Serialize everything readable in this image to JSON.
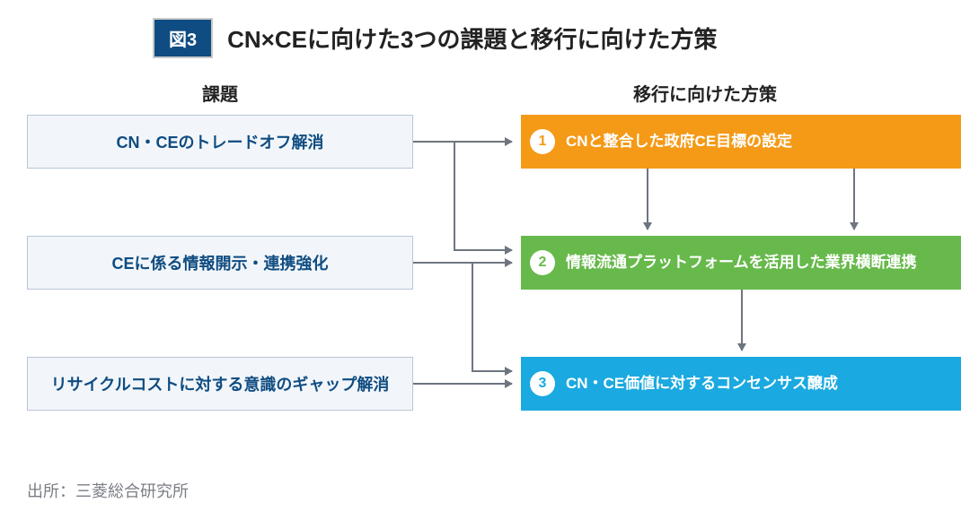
{
  "header": {
    "figure_label": "図3",
    "title": "CN×CEに向けた3つの課題と移行に向けた方策"
  },
  "columns": {
    "left_header": "課題",
    "right_header": "移行に向けた方策"
  },
  "issues": [
    {
      "label": "CN・CEのトレードオフ解消"
    },
    {
      "label": "CEに係る情報開示・連携強化"
    },
    {
      "label": "リサイクルコストに対する意識のギャップ解消"
    }
  ],
  "measures": [
    {
      "num": "1",
      "label": "CNと整合した政府CE目標の設定"
    },
    {
      "num": "2",
      "label": "情報流通プラットフォームを活用した業界横断連携"
    },
    {
      "num": "3",
      "label": "CN・CE価値に対するコンセンサス醸成"
    }
  ],
  "source": "出所：三菱総合研究所",
  "colors": {
    "badge_bg": "#0f4c81",
    "issue_bg": "#f2f6fa",
    "issue_border": "#b8c5d6",
    "issue_text": "#0f4c81",
    "measure1": "#f49a17",
    "measure2": "#67b94b",
    "measure3": "#1aa9e0",
    "arrow": "#6e7580"
  }
}
